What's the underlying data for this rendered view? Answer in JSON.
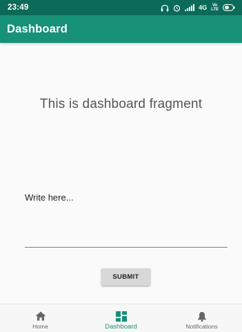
{
  "status_bar": {
    "time": "23:49",
    "network": "4G",
    "lte_top": "Vo",
    "lte_bottom": "LTE"
  },
  "app_bar": {
    "title": "Dashboard"
  },
  "fragment": {
    "text": "This is dashboard fragment"
  },
  "input": {
    "placeholder": "Write here...",
    "value": ""
  },
  "submit_button": {
    "label": "SUBMIT"
  },
  "bottom_nav": {
    "items": [
      {
        "label": "Home",
        "icon": "home-icon",
        "active": false
      },
      {
        "label": "Dashboard",
        "icon": "dashboard-icon",
        "active": true
      },
      {
        "label": "Notifications",
        "icon": "bell-icon",
        "active": false
      }
    ]
  },
  "colors": {
    "status_bar": "#0b6b58",
    "app_bar": "#179178",
    "accent": "#179178",
    "inactive_icon": "#666666"
  }
}
